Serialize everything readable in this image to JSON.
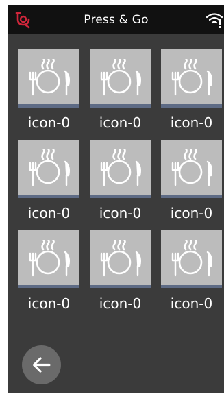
{
  "header": {
    "title": "Press & Go",
    "brand_icon": "bell-logo-icon",
    "status_icon": "wifi-warning-icon"
  },
  "grid": {
    "items": [
      {
        "label": "icon-0",
        "icon": "hot-meal-icon"
      },
      {
        "label": "icon-0",
        "icon": "hot-meal-icon"
      },
      {
        "label": "icon-0",
        "icon": "hot-meal-icon"
      },
      {
        "label": "icon-0",
        "icon": "hot-meal-icon"
      },
      {
        "label": "icon-0",
        "icon": "hot-meal-icon"
      },
      {
        "label": "icon-0",
        "icon": "hot-meal-icon"
      },
      {
        "label": "icon-0",
        "icon": "hot-meal-icon"
      },
      {
        "label": "icon-0",
        "icon": "hot-meal-icon"
      },
      {
        "label": "icon-0",
        "icon": "hot-meal-icon"
      }
    ]
  },
  "footer": {
    "back_icon": "arrow-left-icon"
  },
  "colors": {
    "screen_background": "#3b3b3b",
    "topbar_background": "#111111",
    "brand_red": "#d0263b",
    "tile_background": "#bcbcbc",
    "tile_accent": "#5e6b85",
    "back_button": "#6a6a6a"
  }
}
